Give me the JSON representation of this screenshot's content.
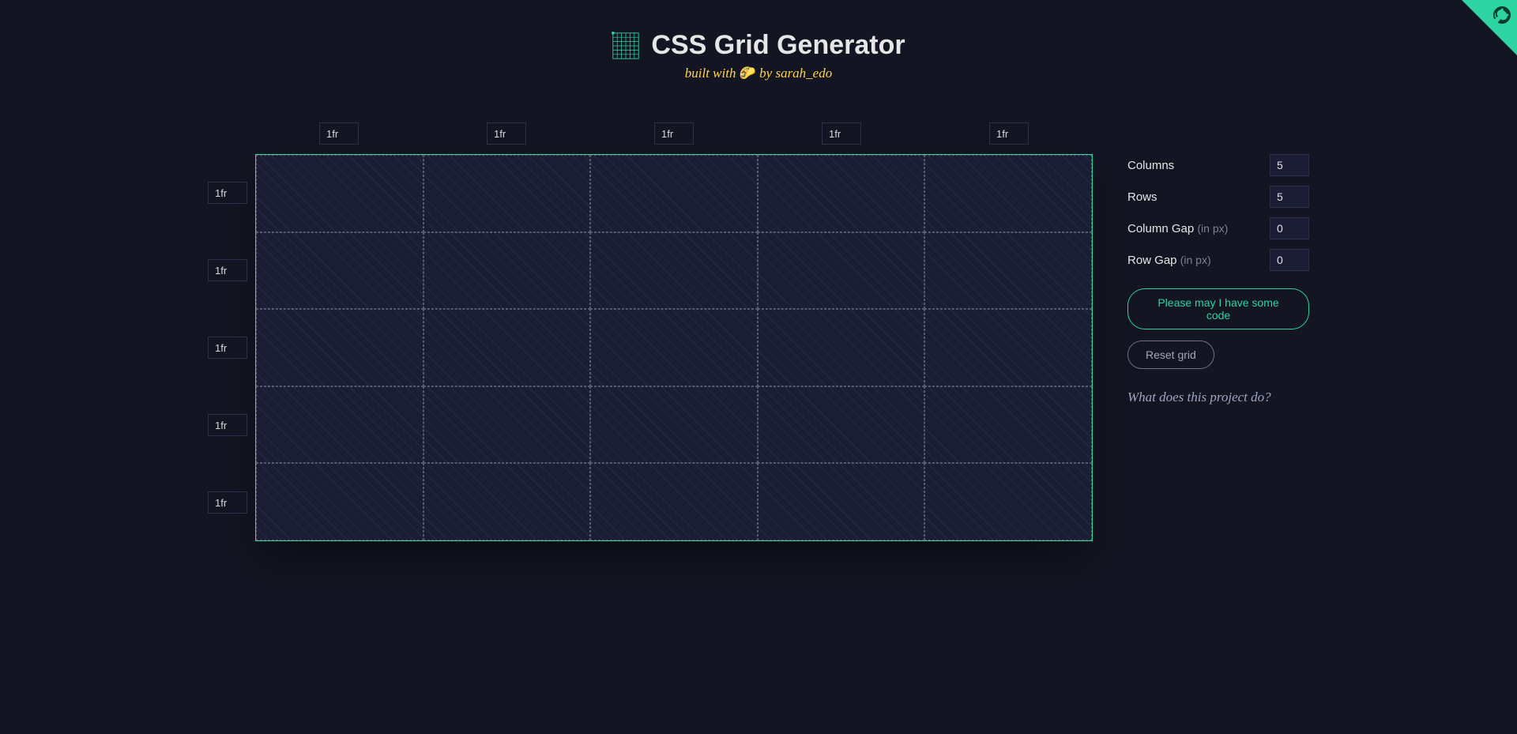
{
  "header": {
    "title": "CSS Grid Generator",
    "subtitle_prefix": "built with ",
    "subtitle_emoji": "🌮",
    "subtitle_suffix": " by sarah_edo"
  },
  "grid": {
    "column_units": [
      "1fr",
      "1fr",
      "1fr",
      "1fr",
      "1fr"
    ],
    "row_units": [
      "1fr",
      "1fr",
      "1fr",
      "1fr",
      "1fr"
    ]
  },
  "controls": {
    "columns_label": "Columns",
    "columns_value": "5",
    "rows_label": "Rows",
    "rows_value": "5",
    "col_gap_label": "Column Gap ",
    "col_gap_hint": "(in px)",
    "col_gap_value": "0",
    "row_gap_label": "Row Gap ",
    "row_gap_hint": "(in px)",
    "row_gap_value": "0",
    "code_btn": "Please may I have some code",
    "reset_btn": "Reset grid",
    "project_link": "What does this project do?"
  },
  "colors": {
    "accent": "#2cd4a2",
    "bg": "#131522"
  }
}
